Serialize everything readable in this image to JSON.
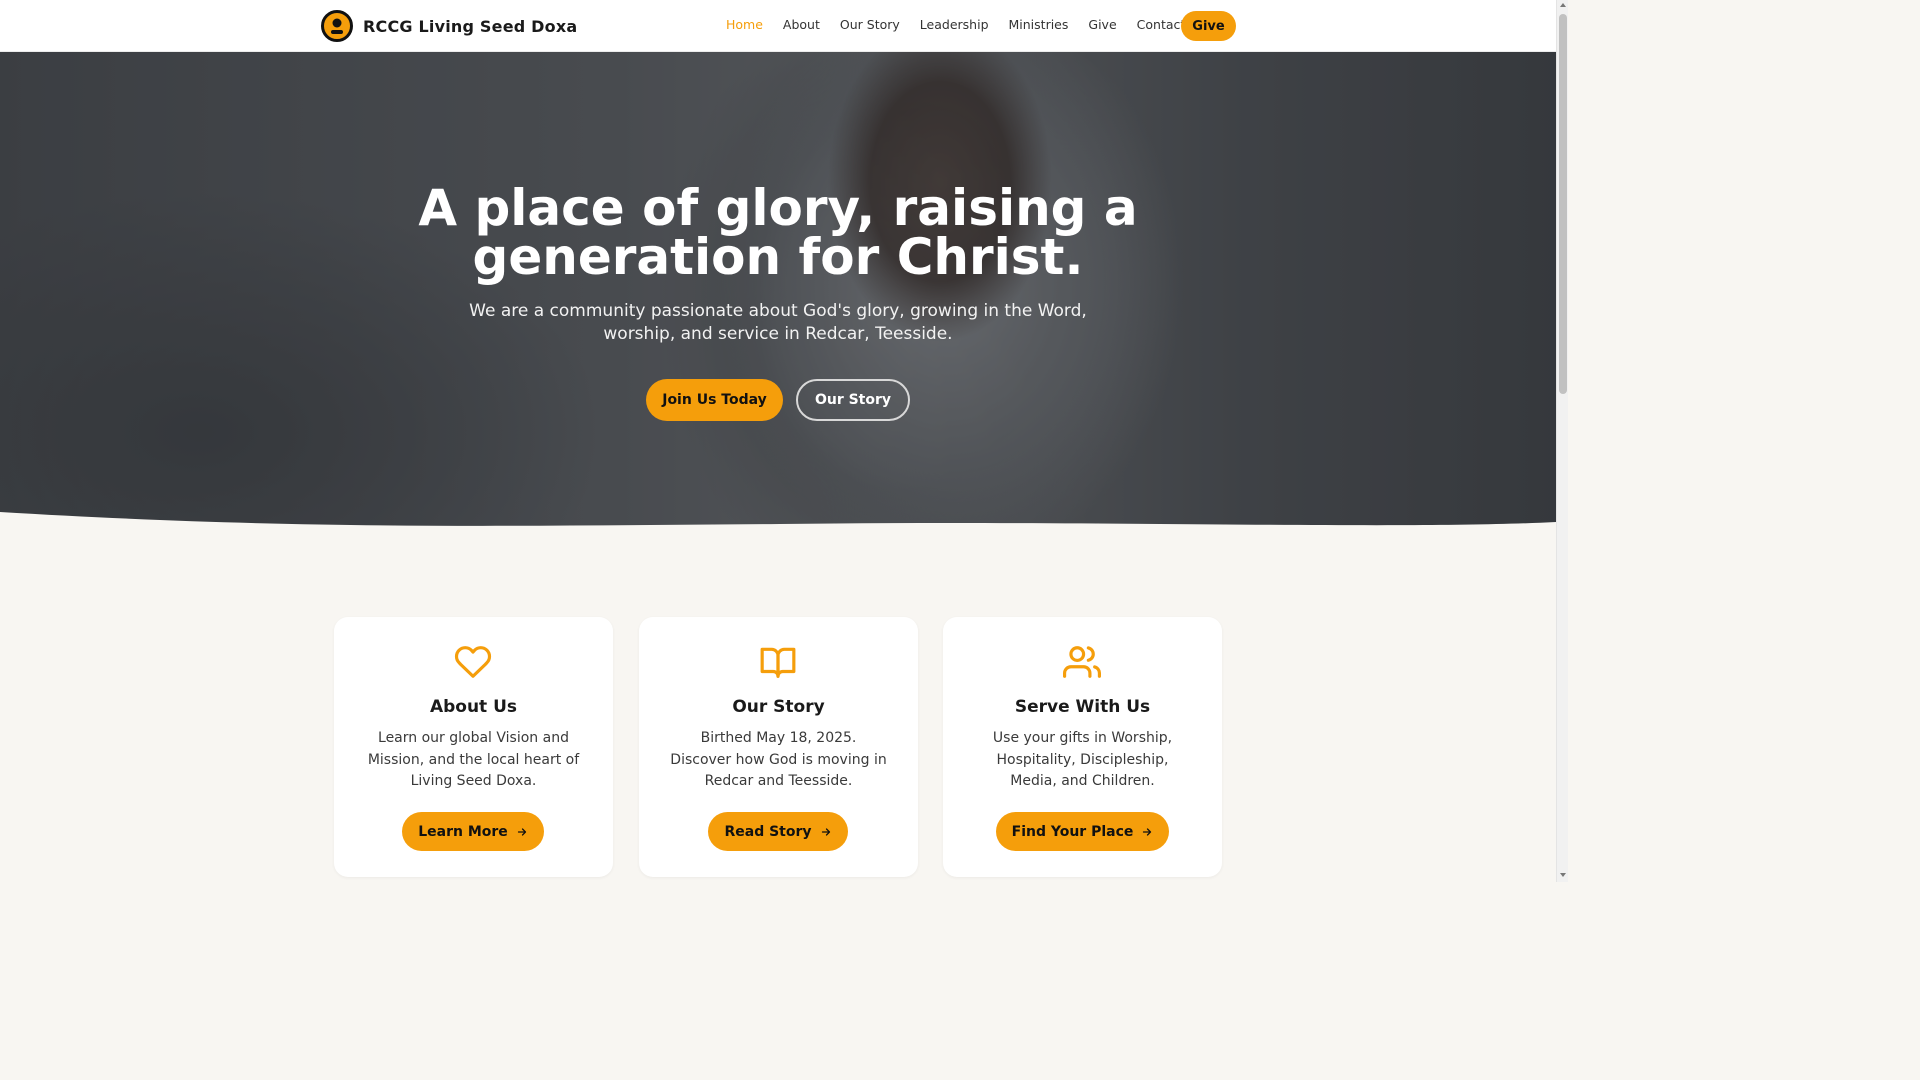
{
  "brand": {
    "name": "RCCG Living Seed Doxa",
    "logo_icon": "church-logo-icon"
  },
  "nav": {
    "items": [
      "Home",
      "About",
      "Our Story",
      "Leadership",
      "Ministries",
      "Give",
      "Contact"
    ],
    "active": "Home",
    "give_label": "Give"
  },
  "hero": {
    "title": "A place of glory, raising a generation for Christ.",
    "subtitle": "We are a community passionate about God's glory, growing in the Word, worship, and service in Redcar, Teesside.",
    "primary_cta": "Join Us Today",
    "secondary_cta": "Our Story"
  },
  "cards": [
    {
      "icon": "heart-icon",
      "title": "About Us",
      "text": "Learn our global Vision and Mission, and the local heart of Living Seed Doxa.",
      "cta": "Learn More"
    },
    {
      "icon": "open-book-icon",
      "title": "Our Story",
      "text": "Birthed May 18, 2025. Discover how God is moving in Redcar and Teesside.",
      "cta": "Read Story"
    },
    {
      "icon": "users-icon",
      "title": "Serve With Us",
      "text": "Use your gifts in Worship, Hospitality, Discipleship, Media, and Children.",
      "cta": "Find Your Place"
    }
  ],
  "colors": {
    "accent": "#f59e0b",
    "background": "#f8f6f2",
    "header": "#ffffff",
    "text": "#1a1a1a"
  }
}
